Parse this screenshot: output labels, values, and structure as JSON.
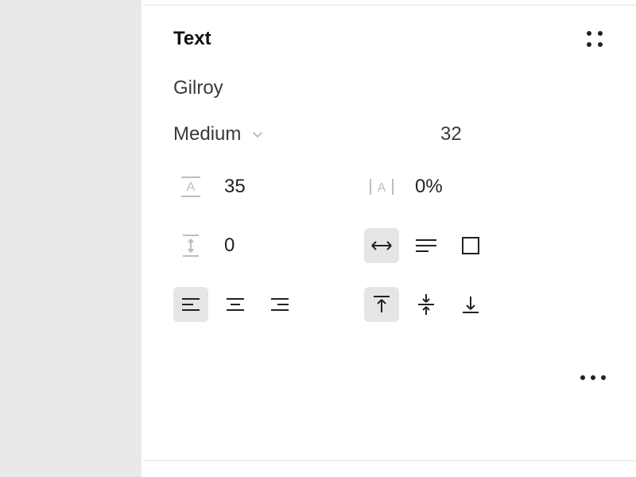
{
  "text_panel": {
    "title": "Text",
    "font_family": "Gilroy",
    "font_weight": "Medium",
    "font_size": "32",
    "line_height": "35",
    "letter_spacing": "0%",
    "paragraph_spacing": "0",
    "auto_width": {
      "selected": true
    },
    "auto_height": {
      "selected": false
    },
    "fixed_size": {
      "selected": false
    },
    "align_h": {
      "left": true,
      "center": false,
      "right": false
    },
    "align_v": {
      "top": true,
      "middle": false,
      "bottom": false
    }
  }
}
